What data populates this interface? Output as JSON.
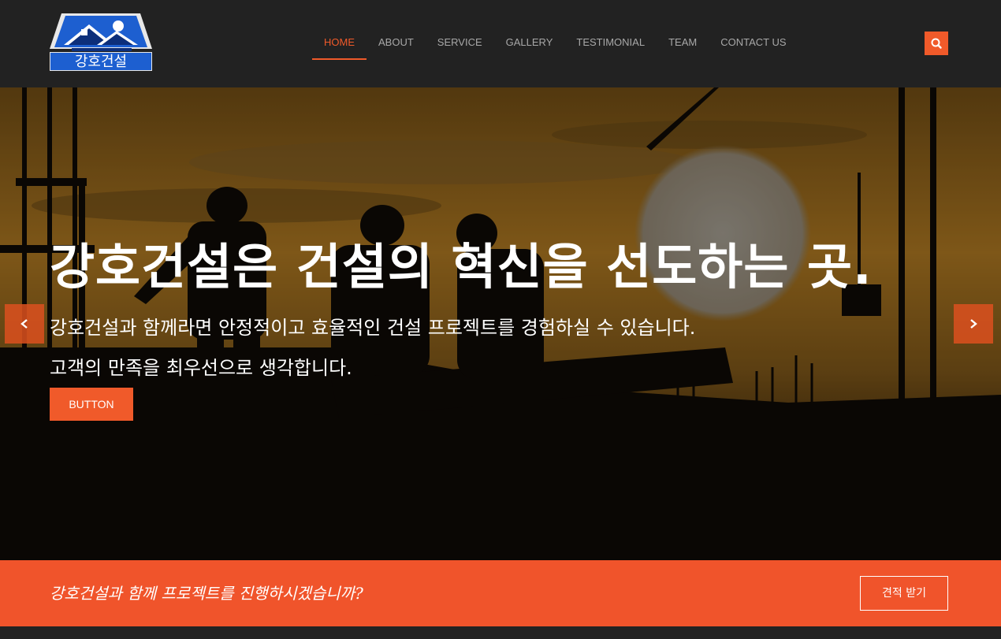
{
  "brand": {
    "logo_text": "강호건설"
  },
  "nav": {
    "items": [
      {
        "label": "HOME",
        "active": true
      },
      {
        "label": "ABOUT"
      },
      {
        "label": "SERVICE"
      },
      {
        "label": "GALLERY"
      },
      {
        "label": "TESTIMONIAL"
      },
      {
        "label": "TEAM"
      },
      {
        "label": "CONTACT US"
      }
    ],
    "search_icon": "search-icon"
  },
  "hero": {
    "title": "강호건설은 건설의 혁신을 선도하는 곳.",
    "subtitle_1": "강호건설과 함께라면 안정적이고 효율적인 건설 프로젝트를 경험하실 수 있습니다.",
    "subtitle_2": "고객의 만족을 최우선으로 생각합니다.",
    "button_label": "BUTTON",
    "prev_icon": "chevron-left-icon",
    "next_icon": "chevron-right-icon"
  },
  "cta": {
    "text": "강호건설과 함께 프로젝트를 진행하시겠습니까?",
    "button_label": "견적 받기"
  },
  "colors": {
    "accent": "#f05a2a",
    "header_bg": "#222222",
    "logo_blue": "#1d5fd0"
  }
}
